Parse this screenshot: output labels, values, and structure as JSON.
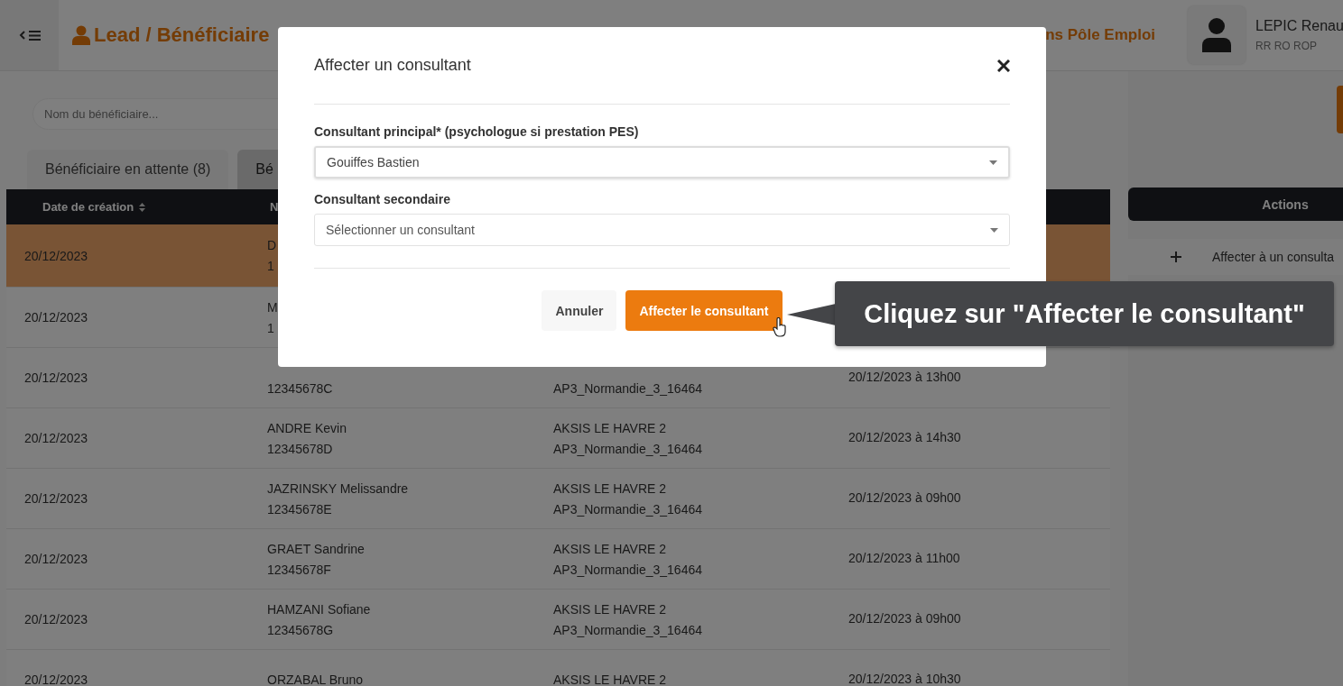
{
  "header": {
    "title": "Lead / Bénéficiaire",
    "program": "ns Pôle Emploi",
    "user": {
      "name": "LEPIC Renau",
      "role": "RR RO ROP"
    }
  },
  "search": {
    "placeholder": "Nom du bénéficiaire..."
  },
  "tabs": [
    {
      "label": "Bénéficiaire en attente (8)",
      "selected": true
    },
    {
      "label": "Bé",
      "selected": false
    }
  ],
  "table": {
    "columns": [
      "Date de création",
      "N"
    ],
    "rows": [
      {
        "date": "20/12/2023",
        "name": "D",
        "id": "1",
        "selected": true
      },
      {
        "date": "20/12/2023",
        "name": "M",
        "id": "1",
        "selected": false
      },
      {
        "date": "20/12/2023",
        "id": "12345678C",
        "code": "AP3_Normandie_3_16464",
        "datetime": "20/12/2023 à 13h00",
        "selected": false
      },
      {
        "date": "20/12/2023",
        "name": "ANDRE Kevin",
        "id": "12345678D",
        "agency": "AKSIS LE HAVRE 2",
        "code": "AP3_Normandie_3_16464",
        "datetime": "20/12/2023 à 14h30",
        "selected": false
      },
      {
        "date": "20/12/2023",
        "name": "JAZRINSKY Melissandre",
        "id": "12345678E",
        "agency": "AKSIS LE HAVRE 2",
        "code": "AP3_Normandie_3_16464",
        "datetime": "20/12/2023 à 09h00",
        "selected": false
      },
      {
        "date": "20/12/2023",
        "name": "GRAET Sandrine",
        "id": "12345678F",
        "agency": "AKSIS LE HAVRE 2",
        "code": "AP3_Normandie_3_16464",
        "datetime": "20/12/2023 à 11h00",
        "selected": false
      },
      {
        "date": "20/12/2023",
        "name": "HAMZANI Sofiane",
        "id": "12345678G",
        "agency": "AKSIS LE HAVRE 2",
        "code": "AP3_Normandie_3_16464",
        "datetime": "20/12/2023 à 09h00",
        "selected": false
      },
      {
        "date": "20/12/2023",
        "name": "ORZABAL Bruno",
        "agency": "AKSIS LE HAVRE 2",
        "datetime": "20/12/2023 à 10h30",
        "selected": false
      }
    ]
  },
  "actions": {
    "title": "Actions",
    "items": [
      {
        "label": "Affecter à un consulta"
      }
    ]
  },
  "modal": {
    "title": "Affecter un consultant",
    "fields": [
      {
        "label": "Consultant principal* (psychologue si prestation PES)",
        "value": "Gouiffes Bastien",
        "focused": true
      },
      {
        "label": "Consultant secondaire",
        "placeholder": "Sélectionner un consultant",
        "focused": false
      }
    ],
    "buttons": [
      {
        "label": "Annuler",
        "kind": "secondary"
      },
      {
        "label": "Affecter le consultant",
        "kind": "primary"
      }
    ]
  },
  "tooltip": {
    "text": "Cliquez sur \"Affecter le consultant\""
  }
}
